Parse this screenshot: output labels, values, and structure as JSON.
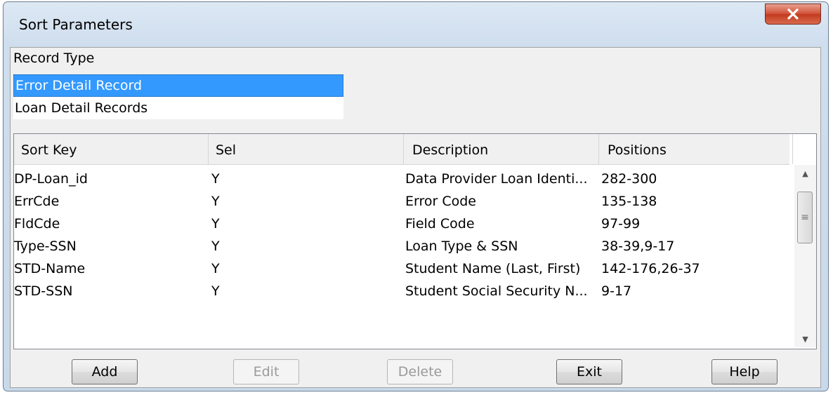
{
  "window": {
    "title": "Sort Parameters"
  },
  "record_type": {
    "label": "Record Type",
    "items": [
      {
        "label": "Error Detail Record",
        "selected": true
      },
      {
        "label": "Loan Detail Records",
        "selected": false
      }
    ]
  },
  "grid": {
    "columns": [
      "Sort Key",
      "Sel",
      "Description",
      "Positions"
    ],
    "rows": [
      [
        "DP-Loan_id",
        "Y",
        "Data Provider Loan Identi...",
        "282-300"
      ],
      [
        "ErrCde",
        "Y",
        "Error Code",
        "135-138"
      ],
      [
        "FldCde",
        "Y",
        "Field Code",
        "97-99"
      ],
      [
        "Type-SSN",
        "Y",
        "Loan Type & SSN",
        "38-39,9-17"
      ],
      [
        "STD-Name",
        "Y",
        "Student Name (Last, First)",
        "142-176,26-37"
      ],
      [
        "STD-SSN",
        "Y",
        "Student Social Security N...",
        "9-17"
      ]
    ]
  },
  "buttons": {
    "add": "Add",
    "edit": "Edit",
    "delete": "Delete",
    "exit": "Exit",
    "help": "Help"
  },
  "colors": {
    "selection": "#3399ff",
    "close_button": "#c94a2f"
  }
}
